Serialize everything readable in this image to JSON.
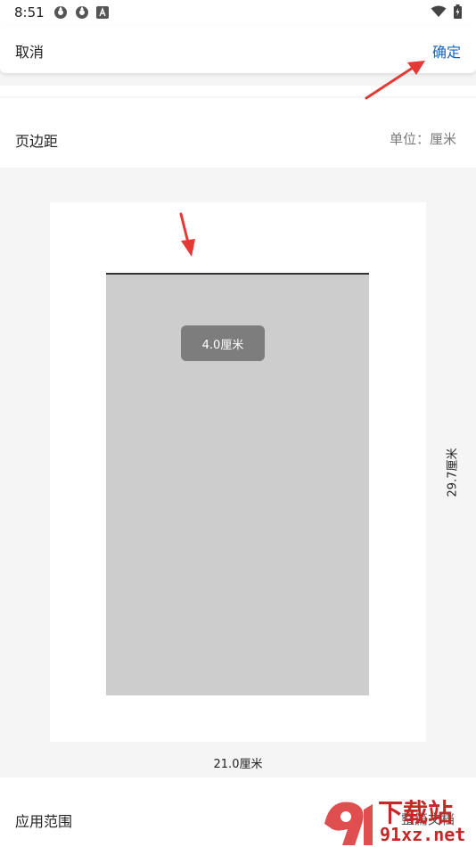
{
  "status_bar": {
    "time": "8:51"
  },
  "header": {
    "cancel_label": "取消",
    "confirm_label": "确定",
    "accent_color": "#1565c0"
  },
  "margin_section": {
    "label": "页边距",
    "unit": "单位：厘米"
  },
  "preview": {
    "top_margin_tooltip": "4.0厘米",
    "page_height": "29.7厘米",
    "page_width": "21.0厘米"
  },
  "apply_section": {
    "label": "应用范围",
    "value": "整篇文档"
  },
  "annotations": {
    "arrow_color": "#e53935"
  },
  "watermark": {
    "brand_text": "下载站",
    "url_text": "91xz.net"
  }
}
